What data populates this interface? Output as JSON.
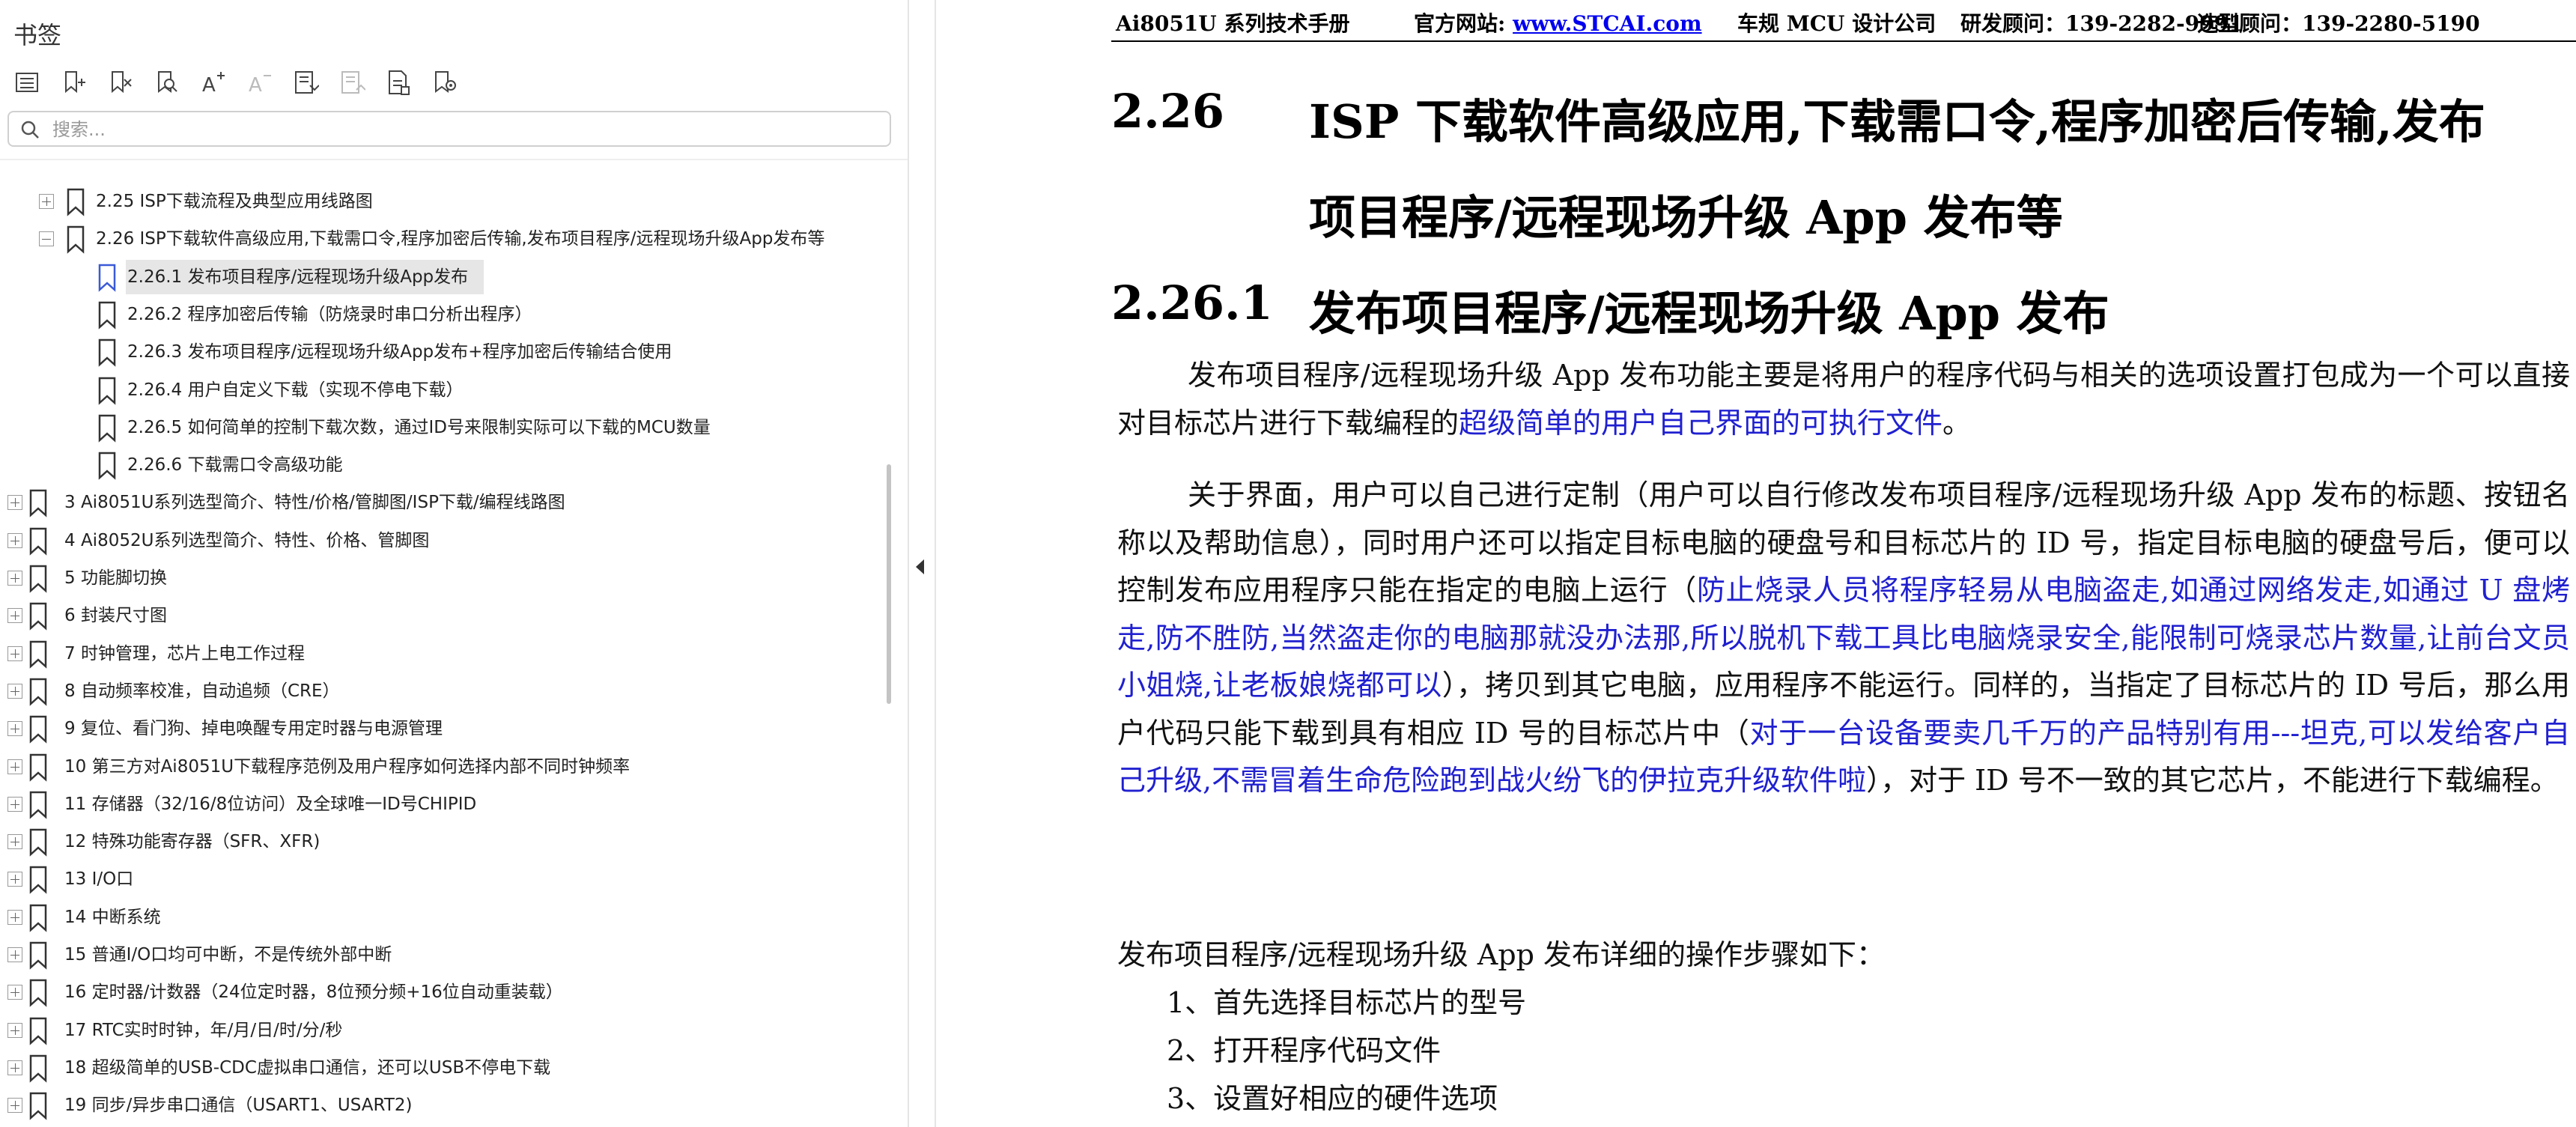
{
  "sidebar": {
    "title": "书签",
    "search_placeholder": "搜索...",
    "toolbar_icons": [
      "bookmark-list-icon",
      "add-bookmark-icon",
      "delete-bookmark-icon",
      "find-bookmark-icon",
      "enlarge-text-icon",
      "shrink-text-icon",
      "expand-bookmark-icon",
      "collapse-bookmark-icon",
      "bookmark-properties-icon",
      "jump-to-bookmark-icon"
    ],
    "items": [
      {
        "label": "2.25  ISP下载流程及典型应用线路图",
        "level": 1,
        "expander": "plus"
      },
      {
        "label": "2.26  ISP下载软件高级应用,下载需口令,程序加密后传输,发布项目程序/远程现场升级App发布等",
        "level": 1,
        "expander": "minus"
      },
      {
        "label": "2.26.1 发布项目程序/远程现场升级App发布",
        "level": 2,
        "expander": "none",
        "selected": true
      },
      {
        "label": "2.26.2 程序加密后传输（防烧录时串口分析出程序）",
        "level": 2,
        "expander": "none"
      },
      {
        "label": "2.26.3  发布项目程序/远程现场升级App发布+程序加密后传输结合使用",
        "level": 2,
        "expander": "none"
      },
      {
        "label": "2.26.4 用户自定义下载（实现不停电下载）",
        "level": 2,
        "expander": "none"
      },
      {
        "label": "2.26.5  如何简单的控制下载次数，通过ID号来限制实际可以下载的MCU数量",
        "level": 2,
        "expander": "none"
      },
      {
        "label": "2.26.6  下载需口令高级功能",
        "level": 2,
        "expander": "none"
      },
      {
        "label": "3  Ai8051U系列选型简介、特性/价格/管脚图/ISP下载/编程线路图",
        "level": 0,
        "expander": "plus"
      },
      {
        "label": "4  Ai8052U系列选型简介、特性、价格、管脚图",
        "level": 0,
        "expander": "plus"
      },
      {
        "label": "5  功能脚切换",
        "level": 0,
        "expander": "plus"
      },
      {
        "label": "6  封装尺寸图",
        "level": 0,
        "expander": "plus"
      },
      {
        "label": "7  时钟管理，芯片上电工作过程",
        "level": 0,
        "expander": "plus"
      },
      {
        "label": "8  自动频率校准，自动追频（CRE）",
        "level": 0,
        "expander": "plus"
      },
      {
        "label": "9  复位、看门狗、掉电唤醒专用定时器与电源管理",
        "level": 0,
        "expander": "plus"
      },
      {
        "label": "10  第三方对Ai8051U下载程序范例及用户程序如何选择内部不同时钟频率",
        "level": 0,
        "expander": "plus"
      },
      {
        "label": "11  存储器（32/16/8位访问）及全球唯一ID号CHIPID",
        "level": 0,
        "expander": "plus"
      },
      {
        "label": "12  特殊功能寄存器（SFR、XFR)",
        "level": 0,
        "expander": "plus"
      },
      {
        "label": "13  I/O口",
        "level": 0,
        "expander": "plus"
      },
      {
        "label": "14  中断系统",
        "level": 0,
        "expander": "plus"
      },
      {
        "label": "15  普通I/O口均可中断，不是传统外部中断",
        "level": 0,
        "expander": "plus"
      },
      {
        "label": "16  定时器/计数器（24位定时器，8位预分频+16位自动重装载）",
        "level": 0,
        "expander": "plus"
      },
      {
        "label": "17  RTC实时时钟，年/月/日/时/分/秒",
        "level": 0,
        "expander": "plus"
      },
      {
        "label": "18  超级简单的USB-CDC虚拟串口通信，还可以USB不停电下载",
        "level": 0,
        "expander": "plus"
      },
      {
        "label": "19  同步/异步串口通信（USART1、USART2)",
        "level": 0,
        "expander": "plus"
      }
    ]
  },
  "doc": {
    "header": {
      "manual": "Ai8051U 系列技术手册",
      "site_label": "官方网站: ",
      "site_link": "www.STCAI.com",
      "company": "车规 MCU 设计公司",
      "rnd": "研发顾问：139-2282-9991",
      "sales": "选型顾问：139-2280-5190"
    },
    "h_226_num": "2.26",
    "h_226_line1": "ISP  下载软件高级应用,下载需口令,程序加密后传输,发布",
    "h_226_line2": "项目程序/远程现场升级 App 发布等",
    "h_2261_num": "2.26.1",
    "h_2261_text": "发布项目程序/远程现场升级 App 发布",
    "p1_a": "发布项目程序/远程现场升级  App  发布功能主要是将用户的程序代码与相关的选项设置打包成为一个可以直接对目标芯片进行下载编程的",
    "p1_blue": "超级简单的用户自己界面的可执行文件",
    "p1_b": "。",
    "p2_a": "关于界面，用户可以自己进行定制（用户可以自行修改发布项目程序/远程现场升级  App  发布的标题、按钮名称以及帮助信息），同时用户还可以指定目标电脑的硬盘号和目标芯片的  ID  号，指定目标电脑的硬盘号后，便可以控制发布应用程序只能在指定的电脑上运行（",
    "p2_blue1": "防止烧录人员将程序轻易从电脑盗走,如通过网络发走,如通过  U  盘烤走,防不胜防,当然盗走你的电脑那就没办法那,所以脱机下载工具比电脑烧录安全,能限制可烧录芯片数量,让前台文员小姐烧,让老板娘烧都可以",
    "p2_b": "），拷贝到其它电脑，应用程序不能运行。同样的，当指定了目标芯片的  ID  号后，那么用户代码只能下载到具有相应  ID  号的目标芯片中（",
    "p2_blue2": "对于一台设备要卖几千万的产品特别有用---坦克,可以发给客户自己升级,不需冒着生命危险跑到战火纷飞的伊拉克升级软件啦",
    "p2_c": "），对于  ID  号不一致的其它芯片，不能进行下载编程。",
    "steps_intro": "发布项目程序/远程现场升级 App 发布详细的操作步骤如下：",
    "steps": [
      "1、首先选择目标芯片的型号",
      "2、打开程序代码文件",
      "3、设置好相应的硬件选项"
    ]
  },
  "colors": {
    "link": "#0000ee",
    "highlight_text": "#2020d0",
    "selected_bg": "#e6e6e6"
  }
}
